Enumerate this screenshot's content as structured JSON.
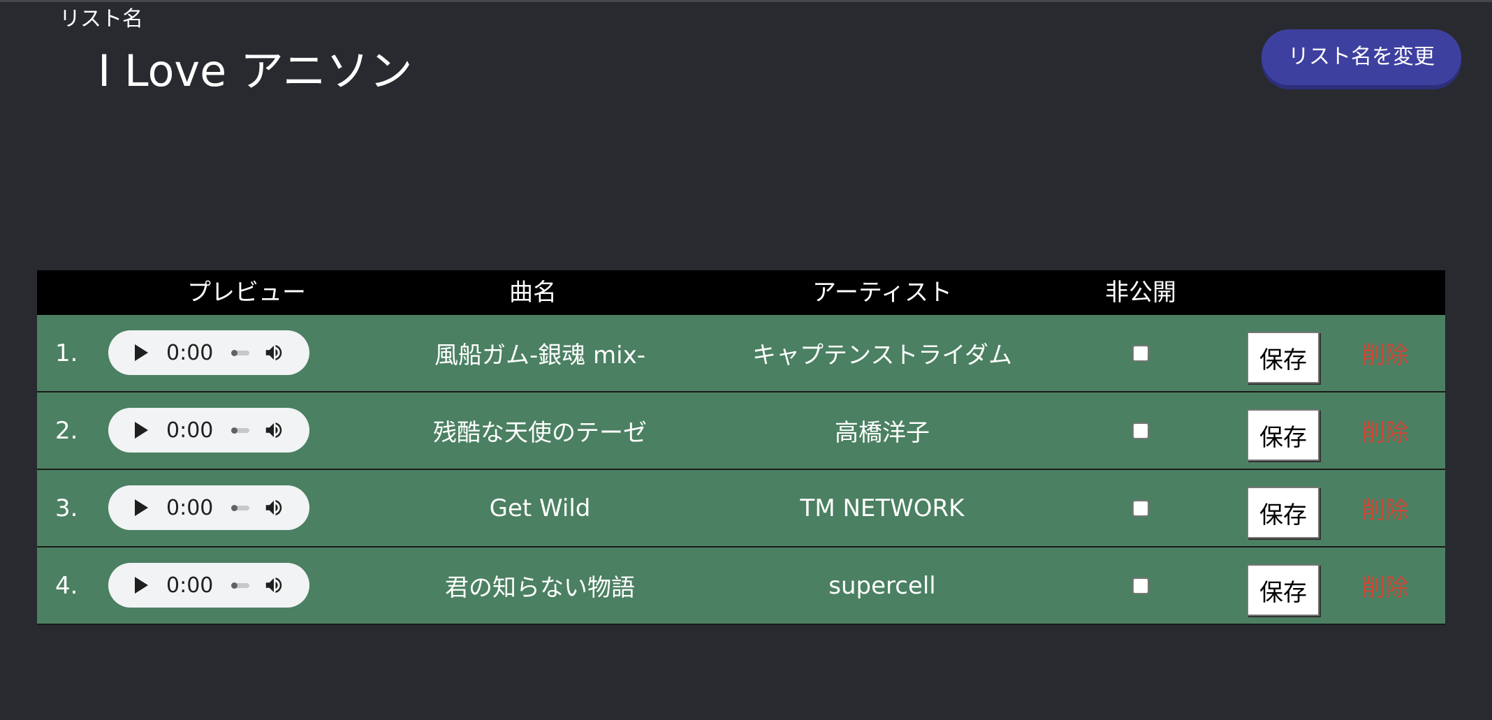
{
  "header": {
    "list_label": "リスト名",
    "list_title": "I Love アニソン",
    "rename_button": "リスト名を変更"
  },
  "table": {
    "headers": {
      "preview": "プレビュー",
      "song": "曲名",
      "artist": "アーティスト",
      "private": "非公開"
    },
    "rows": [
      {
        "num": "1.",
        "time": "0:00",
        "title": "風船ガム-銀魂 mix-",
        "artist": "キャプテンストライダム",
        "private": false,
        "save": "保存",
        "delete": "削除"
      },
      {
        "num": "2.",
        "time": "0:00",
        "title": "残酷な天使のテーゼ",
        "artist": "高橋洋子",
        "private": false,
        "save": "保存",
        "delete": "削除"
      },
      {
        "num": "3.",
        "time": "0:00",
        "title": "Get Wild",
        "artist": "TM NETWORK",
        "private": false,
        "save": "保存",
        "delete": "削除"
      },
      {
        "num": "4.",
        "time": "0:00",
        "title": "君の知らない物語",
        "artist": "supercell",
        "private": false,
        "save": "保存",
        "delete": "削除"
      }
    ]
  },
  "colors": {
    "background": "#282a2f",
    "row_background": "#4b8062",
    "header_background": "#000000",
    "rename_button": "#3e40a0",
    "delete_text": "#c94a3a"
  },
  "icons": {
    "play": "play-icon",
    "volume": "volume-icon"
  }
}
